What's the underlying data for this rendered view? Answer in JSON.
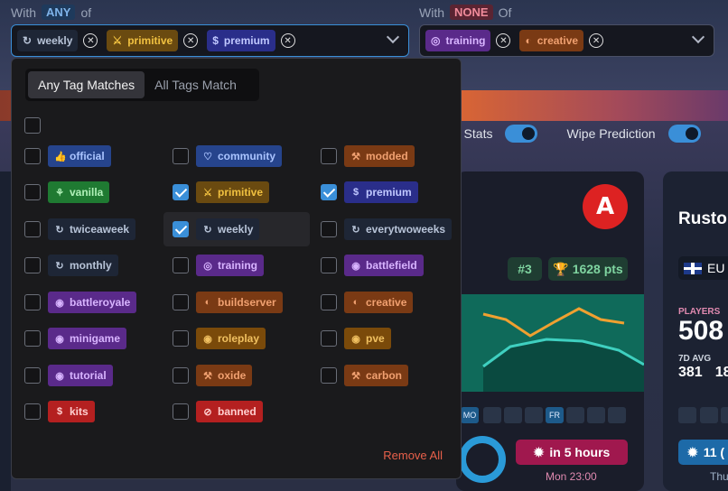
{
  "filter_any": {
    "prefix": "With",
    "keyword": "ANY",
    "suffix": "of",
    "chips": [
      {
        "label": "weekly",
        "icon": "refresh-icon",
        "color": "dark"
      },
      {
        "label": "primitive",
        "icon": "knife-icon",
        "color": "primitive"
      },
      {
        "label": "premium",
        "icon": "dollar-icon",
        "color": "navy"
      }
    ]
  },
  "filter_none": {
    "prefix": "With",
    "keyword": "NONE",
    "suffix": "Of",
    "chips": [
      {
        "label": "training",
        "icon": "target-icon",
        "color": "purple"
      },
      {
        "label": "creative",
        "icon": "palette-icon",
        "color": "orange"
      }
    ]
  },
  "dropdown": {
    "mode_any": "Any Tag Matches",
    "mode_all": "All Tags Match",
    "remove_all": "Remove All",
    "tags": [
      [
        {
          "label": "official",
          "checked": false,
          "color": "blue",
          "icon": "thumb-icon"
        },
        {
          "label": "community",
          "checked": false,
          "color": "blue",
          "icon": "heart-icon"
        },
        {
          "label": "modded",
          "checked": false,
          "color": "orange",
          "icon": "wrench-icon"
        }
      ],
      [
        {
          "label": "vanilla",
          "checked": false,
          "color": "green",
          "icon": "leaf-icon"
        },
        {
          "label": "primitive",
          "checked": true,
          "color": "primitive",
          "icon": "knife-icon"
        },
        {
          "label": "premium",
          "checked": true,
          "color": "navy",
          "icon": "dollar-icon"
        }
      ],
      [
        {
          "label": "twiceaweek",
          "checked": false,
          "color": "dark",
          "icon": "refresh-icon"
        },
        {
          "label": "weekly",
          "checked": true,
          "color": "dark",
          "icon": "refresh-icon"
        },
        {
          "label": "everytwoweeks",
          "checked": false,
          "color": "dark",
          "icon": "refresh-icon"
        }
      ],
      [
        {
          "label": "monthly",
          "checked": false,
          "color": "dark",
          "icon": "refresh-icon"
        },
        {
          "label": "training",
          "checked": false,
          "color": "purple",
          "icon": "target-icon"
        },
        {
          "label": "battlefield",
          "checked": false,
          "color": "purple",
          "icon": "gamepad-icon"
        }
      ],
      [
        {
          "label": "battleroyale",
          "checked": false,
          "color": "purple",
          "icon": "gamepad-icon"
        },
        {
          "label": "buildserver",
          "checked": false,
          "color": "orange",
          "icon": "palette-icon"
        },
        {
          "label": "creative",
          "checked": false,
          "color": "orange",
          "icon": "palette-icon"
        }
      ],
      [
        {
          "label": "minigame",
          "checked": false,
          "color": "purple",
          "icon": "gamepad-icon"
        },
        {
          "label": "roleplay",
          "checked": false,
          "color": "brown",
          "icon": "gamepad-icon"
        },
        {
          "label": "pve",
          "checked": false,
          "color": "brown",
          "icon": "gamepad-icon"
        }
      ],
      [
        {
          "label": "tutorial",
          "checked": false,
          "color": "purple",
          "icon": "gamepad-icon"
        },
        {
          "label": "oxide",
          "checked": false,
          "color": "orange",
          "icon": "wrench-icon"
        },
        {
          "label": "carbon",
          "checked": false,
          "color": "orange",
          "icon": "wrench-icon"
        }
      ],
      [
        {
          "label": "kits",
          "checked": false,
          "color": "red",
          "icon": "dollar-icon"
        },
        {
          "label": "banned",
          "checked": false,
          "color": "red",
          "icon": "ban-icon"
        }
      ]
    ]
  },
  "background": {
    "toggle_stats": "r Stats",
    "toggle_wipe": "Wipe Prediction",
    "rank": "#3",
    "points": "1628 pts",
    "day_mo": "MO",
    "day_fr": "FR",
    "wipe_btn": "in 5 hours",
    "wipe_time": "Mon 23:00",
    "server_title": "Rusto",
    "region": "EU",
    "players_label": "PLAYERS",
    "players_value": "508",
    "avg_label": "7D AVG",
    "avg_value": "381",
    "avg_value2": "18",
    "wipe_btn2": "11 (",
    "thu": "Thu",
    "logo_letter": "A"
  }
}
